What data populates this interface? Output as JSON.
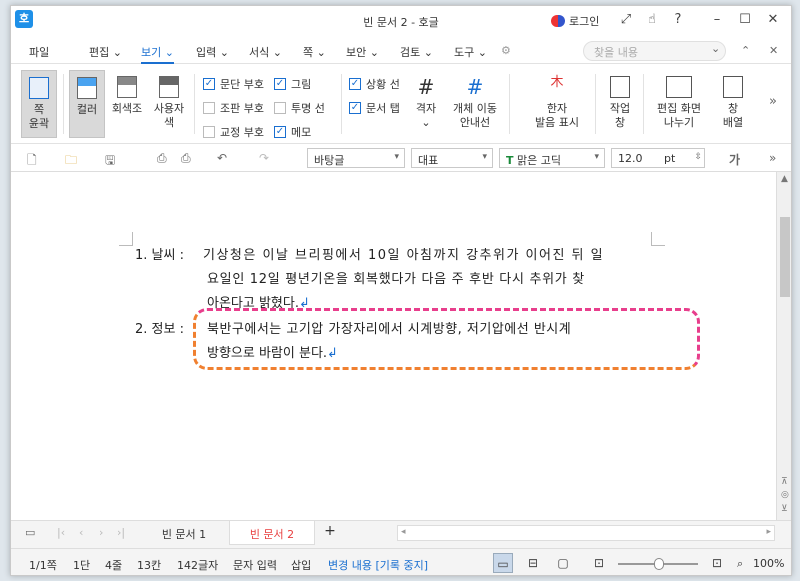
{
  "titlebar": {
    "app_icon": "호",
    "title": "빈 문서 2 - 호글",
    "login": "로그인"
  },
  "menubar": {
    "items": [
      "파일",
      "편집",
      "보기",
      "입력",
      "서식",
      "쪽",
      "보안",
      "검토",
      "도구"
    ],
    "search_placeholder": "찾을 내용"
  },
  "ribbon": {
    "page_outline": "쪽\n윤곽",
    "color": "컬러",
    "gray": "회색조",
    "user_color": "사용자\n색",
    "checks": [
      {
        "label": "문단 부호",
        "checked": true
      },
      {
        "label": "조판 부호",
        "checked": false
      },
      {
        "label": "교정 부호",
        "checked": false
      },
      {
        "label": "그림",
        "checked": true
      },
      {
        "label": "투명 선",
        "checked": false
      },
      {
        "label": "메모",
        "checked": true
      },
      {
        "label": "상황 선",
        "checked": true
      },
      {
        "label": "문서 탭",
        "checked": true
      }
    ],
    "grid": "격자",
    "object_guide": "개체 이동\n안내선",
    "hanja": "한자\n발음 표시",
    "task_window": "작업\n창",
    "split": "편집 화면\n나누기",
    "arrange": "창\n배열"
  },
  "toolbar": {
    "style": "바탕글",
    "level": "대표",
    "font": "맑은 고딕",
    "size": "12.0",
    "unit": "pt",
    "more": "가"
  },
  "document": {
    "item1_label": "1. 날씨 :",
    "item1_lines": [
      "기상청은 이날 브리핑에서 10일 아침까지 강추위가 이어진 뒤 일",
      "요일인 12일 평년기온을 회복했다가 다음 주 후반 다시 추위가 찾",
      "아온다고 밝혔다."
    ],
    "item2_label": "2. 정보 :",
    "item2_lines": [
      "북반구에서는 고기압 가장자리에서 시계방향, 저기압에선 반시계",
      "방향으로 바람이 분다."
    ]
  },
  "tabs": {
    "tab1": "빈 문서 1",
    "tab2": "빈 문서 2",
    "add": "+"
  },
  "status": {
    "page": "1/1쪽",
    "section": "1단",
    "line": "4줄",
    "col": "13칸",
    "chars": "142글자",
    "mode": "문자 입력",
    "insert": "삽입",
    "track": "변경 내용 [기록 중지]",
    "zoom": "100%"
  },
  "colors": {
    "accent": "#1a6fd0",
    "active_tab": "#e83e3e",
    "highlight_pink": "#e83e8c",
    "highlight_orange": "#f08030"
  }
}
